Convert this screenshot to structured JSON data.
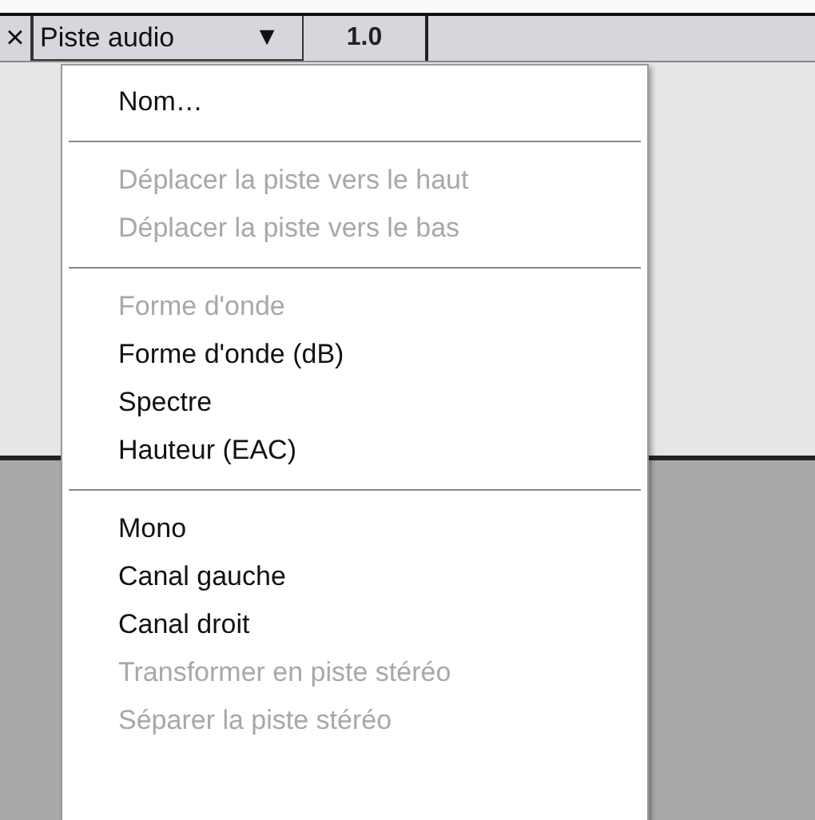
{
  "track_header": {
    "close_label": "×",
    "name": "Piste audio",
    "dropdown_arrow": "▼",
    "value": "1.0"
  },
  "menu": {
    "items": [
      {
        "kind": "item",
        "label": "Nom…",
        "disabled": false
      },
      {
        "kind": "separator"
      },
      {
        "kind": "item",
        "label": "Déplacer la piste vers le haut",
        "disabled": true
      },
      {
        "kind": "item",
        "label": "Déplacer la piste vers le bas",
        "disabled": true
      },
      {
        "kind": "separator"
      },
      {
        "kind": "item",
        "label": "Forme d'onde",
        "disabled": true
      },
      {
        "kind": "item",
        "label": "Forme d'onde (dB)",
        "disabled": false
      },
      {
        "kind": "item",
        "label": "Spectre",
        "disabled": false
      },
      {
        "kind": "item",
        "label": "Hauteur (EAC)",
        "disabled": false
      },
      {
        "kind": "separator"
      },
      {
        "kind": "item",
        "label": "Mono",
        "disabled": false
      },
      {
        "kind": "item",
        "label": "Canal gauche",
        "disabled": false
      },
      {
        "kind": "item",
        "label": "Canal droit",
        "disabled": false
      },
      {
        "kind": "item",
        "label": "Transformer en piste stéréo",
        "disabled": true
      },
      {
        "kind": "item",
        "label": "Séparer la piste stéréo",
        "disabled": true
      }
    ]
  }
}
